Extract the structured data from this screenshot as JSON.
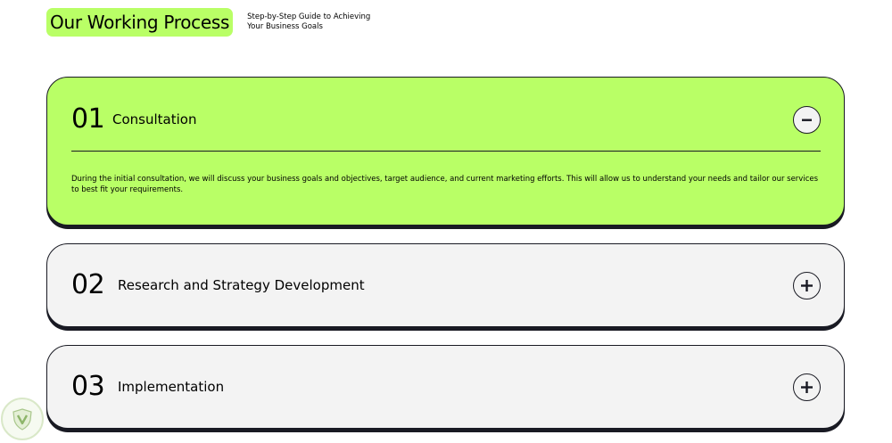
{
  "header": {
    "title": "Our Working Process",
    "subtitle": "Step-by-Step Guide to Achieving Your Business Goals"
  },
  "steps": [
    {
      "number": "01",
      "title": "Consultation",
      "expanded": true,
      "toggle_icon": "minus-icon",
      "description": "During the initial consultation, we will discuss your business goals and objectives, target audience, and current marketing efforts. This will allow us to understand your needs and tailor our services to best fit your requirements."
    },
    {
      "number": "02",
      "title": "Research and Strategy Development",
      "expanded": false,
      "toggle_icon": "plus-icon"
    },
    {
      "number": "03",
      "title": "Implementation",
      "expanded": false,
      "toggle_icon": "plus-icon"
    }
  ],
  "colors": {
    "accent": "#b9ff66",
    "card_bg": "#f3f3f3",
    "dark": "#191a23"
  },
  "badge": {
    "icon": "shield-logo-icon"
  }
}
